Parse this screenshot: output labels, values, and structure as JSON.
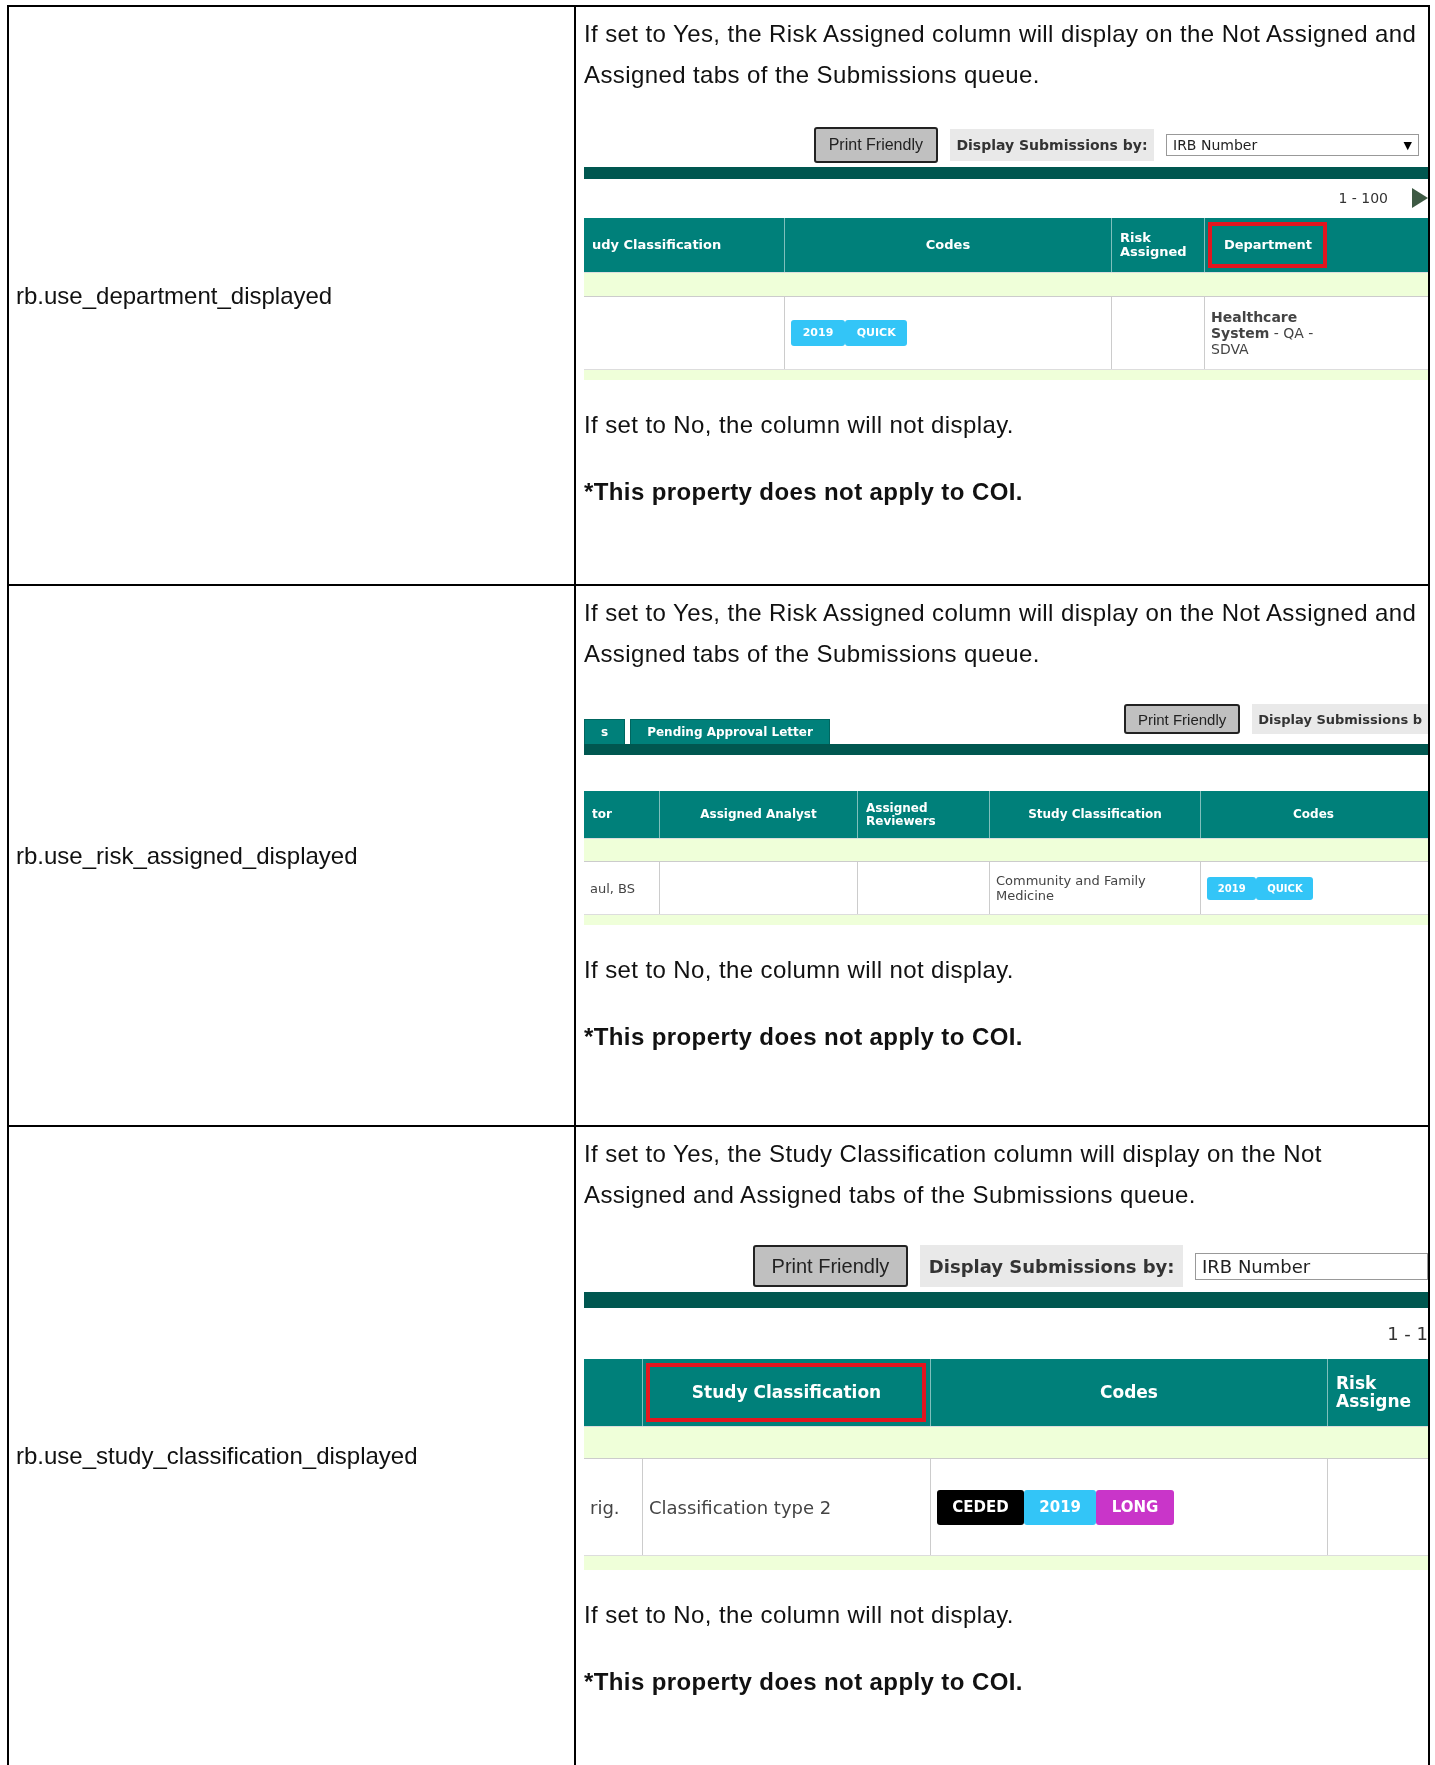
{
  "rows": [
    {
      "property": "rb.use_department_displayed",
      "description": "If set to Yes, the Risk Assigned column will display on the Not Assigned and Assigned tabs of the Submissions queue.",
      "screenshot": {
        "print_button": "Print Friendly",
        "display_label": "Display Submissions by:",
        "select": {
          "value": "IRB Number",
          "caret": "▼"
        },
        "pager": {
          "range": "1 - 100",
          "next_arrow": true
        },
        "columns": [
          {
            "label": "udy Classification",
            "highlighted": false
          },
          {
            "label": "Codes",
            "highlighted": false,
            "cell": {
              "codes": [
                {
                  "label": "2019",
                  "color": "#33c5f7"
                },
                {
                  "label": "QUICK",
                  "color": "#33c5f7"
                }
              ]
            }
          },
          {
            "label": "Risk Assigned",
            "highlighted": false
          },
          {
            "label": "Department",
            "highlighted": true,
            "cell": {
              "text": "**Healthcare System** - QA - SDVA"
            }
          }
        ]
      },
      "no_text": "If set to No, the column will not display.",
      "note": "*This property does not apply to COI."
    },
    {
      "property": "rb.use_risk_assigned_displayed",
      "description": "If set to Yes, the Risk Assigned column will display on the Not Assigned and Assigned tabs of the Submissions queue.",
      "screenshot": {
        "tabs": [
          {
            "label": "s",
            "selected": false
          },
          {
            "label": "Pending Approval Letter",
            "selected": false
          }
        ],
        "print_button": "Print Friendly",
        "display_label": "Display Submissions b",
        "columns": [
          {
            "label": "tor",
            "highlighted": false,
            "cell": {
              "text": "aul, BS"
            }
          },
          {
            "label": "Assigned Analyst",
            "highlighted": false
          },
          {
            "label": "Assigned Reviewers",
            "highlighted": false
          },
          {
            "label": "Study Classification",
            "highlighted": false,
            "cell": {
              "text": "Community and Family Medicine"
            }
          },
          {
            "label": "Codes",
            "highlighted": false,
            "cell": {
              "codes": [
                {
                  "label": "2019",
                  "color": "#33c5f7"
                },
                {
                  "label": "QUICK",
                  "color": "#33c5f7"
                }
              ]
            }
          }
        ]
      },
      "no_text": "If set to No, the column will not display.",
      "note": "*This property does not apply to COI."
    },
    {
      "property": "rb.use_study_classification_displayed",
      "description": "If set to Yes, the Study Classification column will display on the Not Assigned and Assigned tabs of the Submissions queue.",
      "screenshot": {
        "print_button": "Print Friendly",
        "display_label": "Display Submissions by:",
        "select": {
          "value": "IRB Number"
        },
        "pager": {
          "range": "1 - 1"
        },
        "columns": [
          {
            "cell": {
              "text": "rig."
            }
          },
          {
            "label": "Study Classification",
            "highlighted": true,
            "cell": {
              "text": "Classification type 2"
            }
          },
          {
            "label": "Codes",
            "highlighted": false,
            "cell": {
              "codes": [
                {
                  "label": "CEDED",
                  "color": "#000000"
                },
                {
                  "label": "2019",
                  "color": "#33c5f7"
                },
                {
                  "label": "LONG",
                  "color": "#c935c9"
                }
              ]
            }
          },
          {
            "label": "Risk Assigne",
            "highlighted": false
          }
        ]
      },
      "no_text": "If set to No, the column will not display.",
      "note": "*This property does not apply to COI."
    }
  ]
}
